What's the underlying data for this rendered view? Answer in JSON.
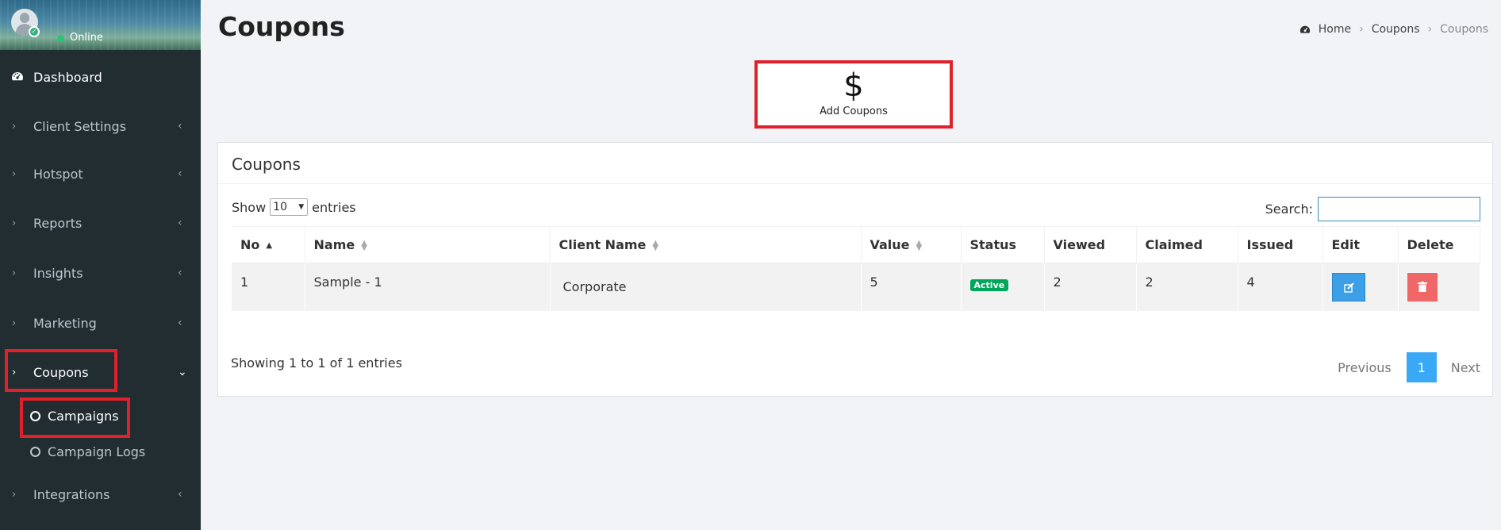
{
  "sidebar": {
    "status": "Online",
    "dashboard": "Dashboard",
    "items": [
      {
        "label": "Client Settings"
      },
      {
        "label": "Hotspot"
      },
      {
        "label": "Reports"
      },
      {
        "label": "Insights"
      },
      {
        "label": "Marketing"
      },
      {
        "label": "Coupons"
      },
      {
        "label": "Integrations"
      }
    ],
    "sub_items": [
      {
        "label": "Campaigns"
      },
      {
        "label": "Campaign Logs"
      }
    ]
  },
  "header": {
    "title": "Coupons",
    "breadcrumb": [
      "Home",
      "Coupons",
      "Coupons"
    ]
  },
  "add_button": {
    "icon": "$",
    "label": "Add Coupons"
  },
  "box": {
    "title": "Coupons",
    "show": "Show",
    "length_value": "10",
    "entries": "entries",
    "search_label": "Search:",
    "search_value": ""
  },
  "table": {
    "columns": [
      "No",
      "Name",
      "Client Name",
      "Value",
      "Status",
      "Viewed",
      "Claimed",
      "Issued",
      "Edit",
      "Delete"
    ],
    "rows": [
      {
        "no": "1",
        "name": "Sample - 1",
        "client": "Corporate",
        "value": "5",
        "status": "Active",
        "viewed": "2",
        "claimed": "2",
        "issued": "4"
      }
    ]
  },
  "footer": {
    "showing": "Showing 1 to 1 of 1 entries",
    "previous": "Previous",
    "page": "1",
    "next": "Next"
  },
  "colors": {
    "sidebar": "#222d32",
    "accent_blue": "#3aa9f5",
    "active_badge": "#00a65a",
    "delete_red": "#f06767",
    "highlight_red": "#e0202a"
  }
}
